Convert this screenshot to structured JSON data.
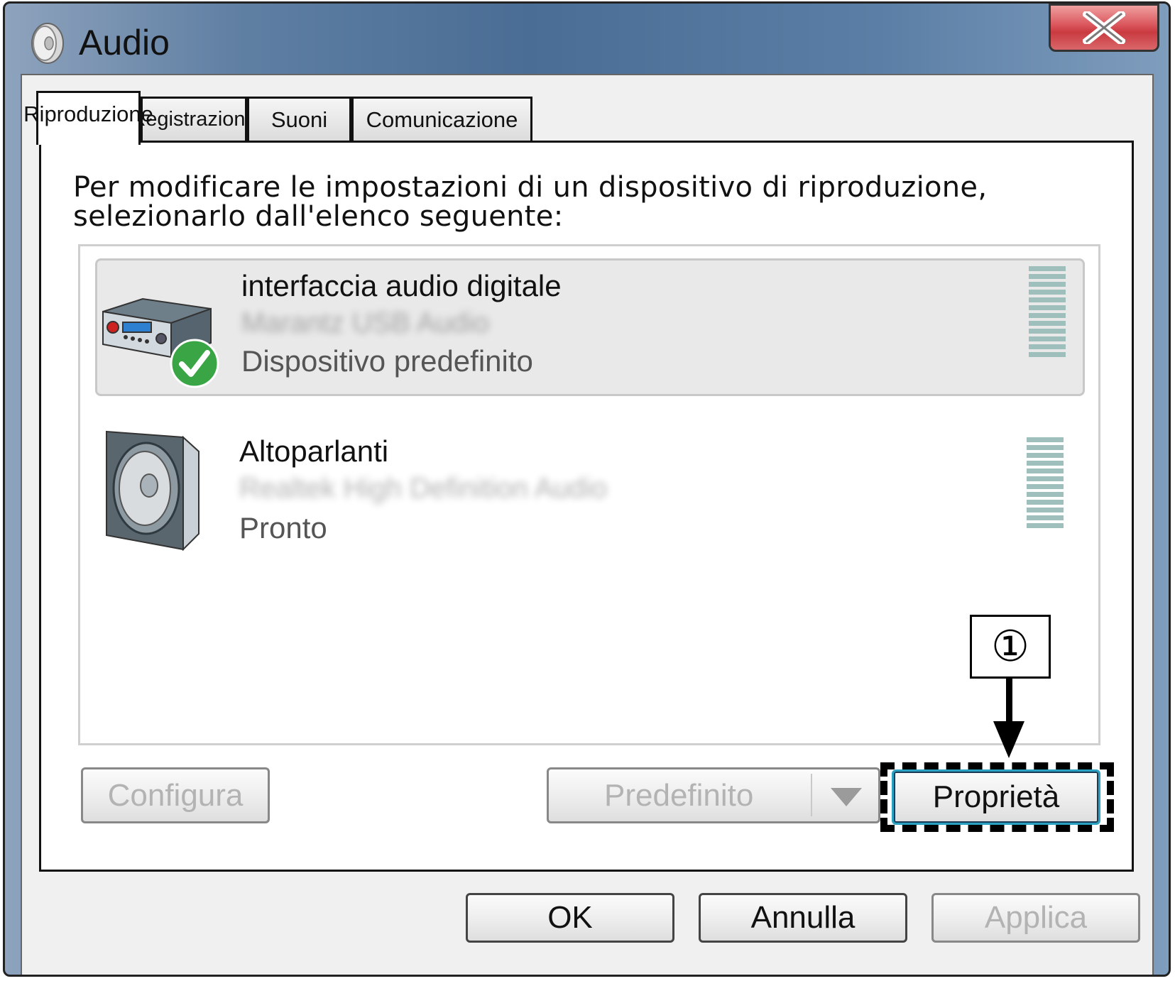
{
  "window": {
    "title": "Audio",
    "close_glyph": "X",
    "title_icon": "speaker-icon"
  },
  "tabs": [
    {
      "label": "Riproduzione",
      "active": true
    },
    {
      "label": "Registrazione",
      "active": false
    },
    {
      "label": "Suoni",
      "active": false
    },
    {
      "label": "Comunicazione",
      "active": false
    }
  ],
  "instruction": {
    "line1": "Per modificare le impostazioni di un dispositivo di riproduzione,",
    "line2": "selezionarlo dall'elenco seguente:"
  },
  "devices": [
    {
      "name": "interfaccia audio digitale",
      "subtitle": "Marantz USB Audio",
      "status": "Dispositivo predefinito",
      "selected": true,
      "icon": "audio-interface-icon",
      "badge": "default-check-icon"
    },
    {
      "name": "Altoparlanti",
      "subtitle": "Realtek High Definition Audio",
      "status": "Pronto",
      "selected": false,
      "icon": "speaker-device-icon"
    }
  ],
  "panel_buttons": {
    "configure": "Configura",
    "set_default": "Predefinito",
    "properties": "Proprietà"
  },
  "dialog_buttons": {
    "ok": "OK",
    "cancel": "Annulla",
    "apply": "Applica"
  },
  "annotation": {
    "callout": "①"
  },
  "colors": {
    "title_bar": "#4a6d95",
    "close_button": "#c93a40",
    "check_badge": "#3aa544",
    "meter": "#9fbfbd",
    "focus_ring": "#2aa1c0"
  }
}
